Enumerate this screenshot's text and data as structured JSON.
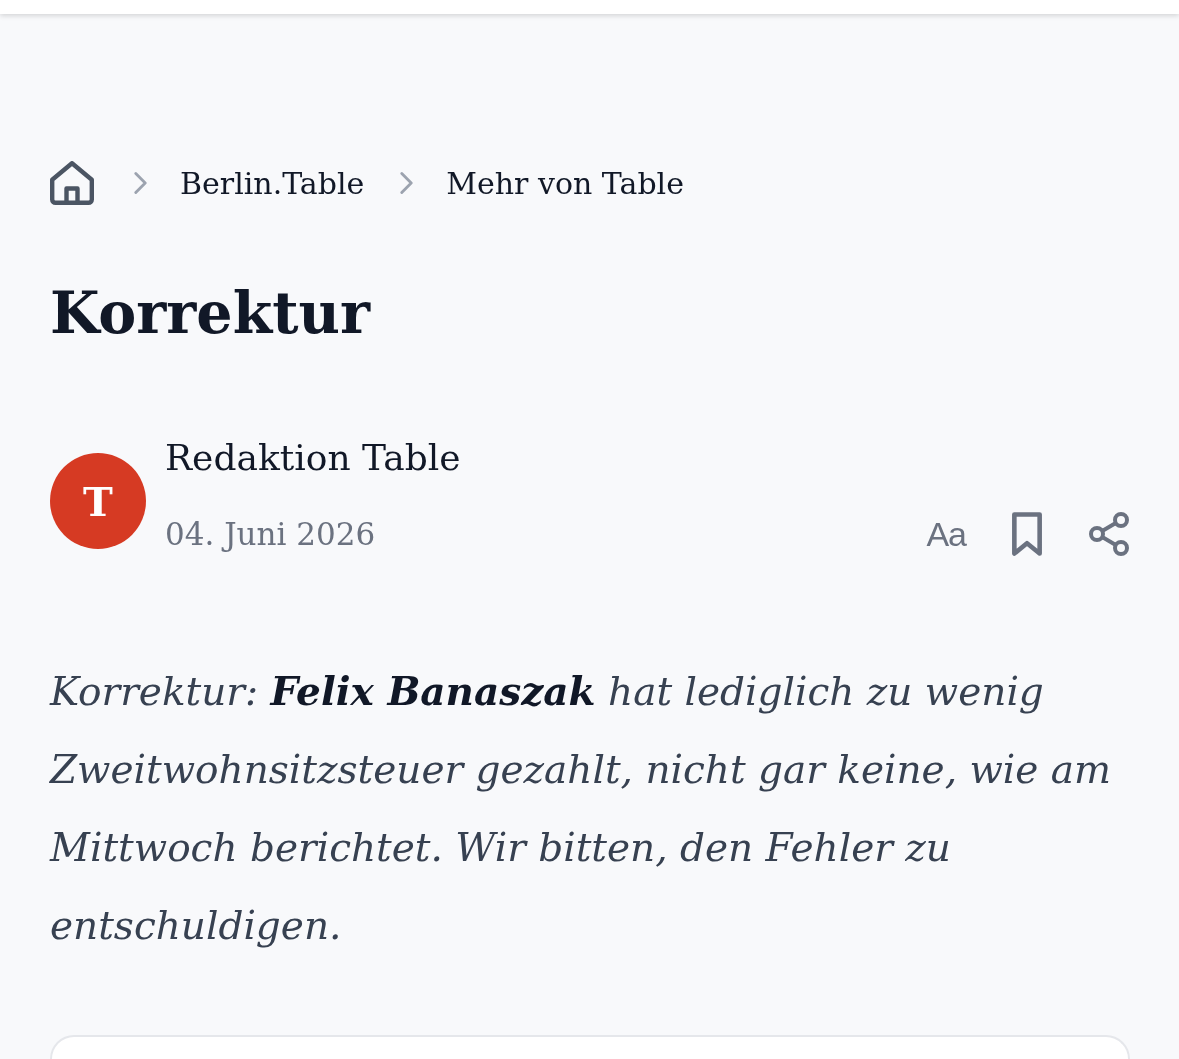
{
  "breadcrumb": {
    "items": [
      {
        "label": "Berlin.Table"
      },
      {
        "label": "Mehr von Table"
      }
    ]
  },
  "article": {
    "title": "Korrektur",
    "author": {
      "avatar_letter": "T",
      "name": "Redaktion Table",
      "date": "04. Juni 2026"
    },
    "actions": [
      {
        "kind": "text_size",
        "label": "Aa"
      },
      {
        "kind": "bookmark"
      },
      {
        "kind": "share"
      }
    ],
    "body": "Korrektur: **Felix Banaszak** hat lediglich zu wenig Zweitwohnsitzsteuer gezahlt, nicht gar keine, wie am Mittwoch berichtet. Wir bitten, den Fehler zu entschuldigen."
  }
}
